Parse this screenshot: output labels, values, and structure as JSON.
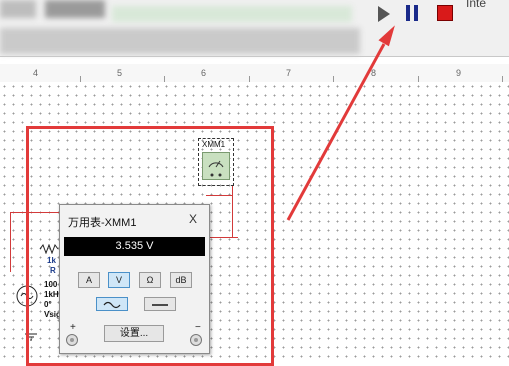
{
  "toolbar": {
    "right_label": "Inte"
  },
  "ruler": {
    "ticks": [
      "4",
      "5",
      "6",
      "7",
      "8",
      "9"
    ]
  },
  "instrument_symbol": {
    "label": "XMM1"
  },
  "multimeter": {
    "title": "万用表-XMM1",
    "close": "X",
    "reading": "3.535 V",
    "modes": [
      "A",
      "V",
      "Ω",
      "dB"
    ],
    "selected_mode": "V",
    "settings_label": "设置...",
    "plus": "+",
    "minus": "−"
  },
  "schematic": {
    "labels": [
      "1k",
      "R",
      "100",
      "1kH",
      "0°",
      "Vsig"
    ]
  },
  "colors": {
    "annotation": "#e23a3a",
    "display_bg": "#000000",
    "display_text": "#ffffff"
  }
}
